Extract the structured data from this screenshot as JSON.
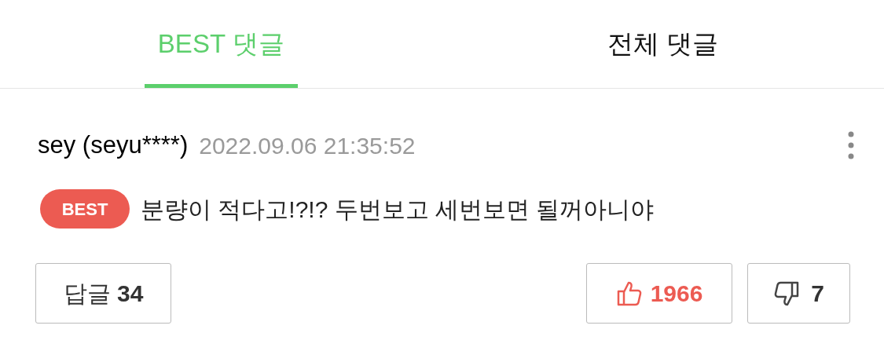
{
  "tabs": [
    {
      "label": "BEST 댓글",
      "selected": true
    },
    {
      "label": "전체 댓글",
      "selected": false
    }
  ],
  "comment": {
    "author": "sey (seyu****)",
    "timestamp": "2022.09.06 21:35:52",
    "badge": "BEST",
    "text": "분량이 적다고!?!? 두번보고 세번보면 될꺼아니야",
    "reply_button": "답글 **34**",
    "likes": "1966",
    "dislikes": "7"
  }
}
